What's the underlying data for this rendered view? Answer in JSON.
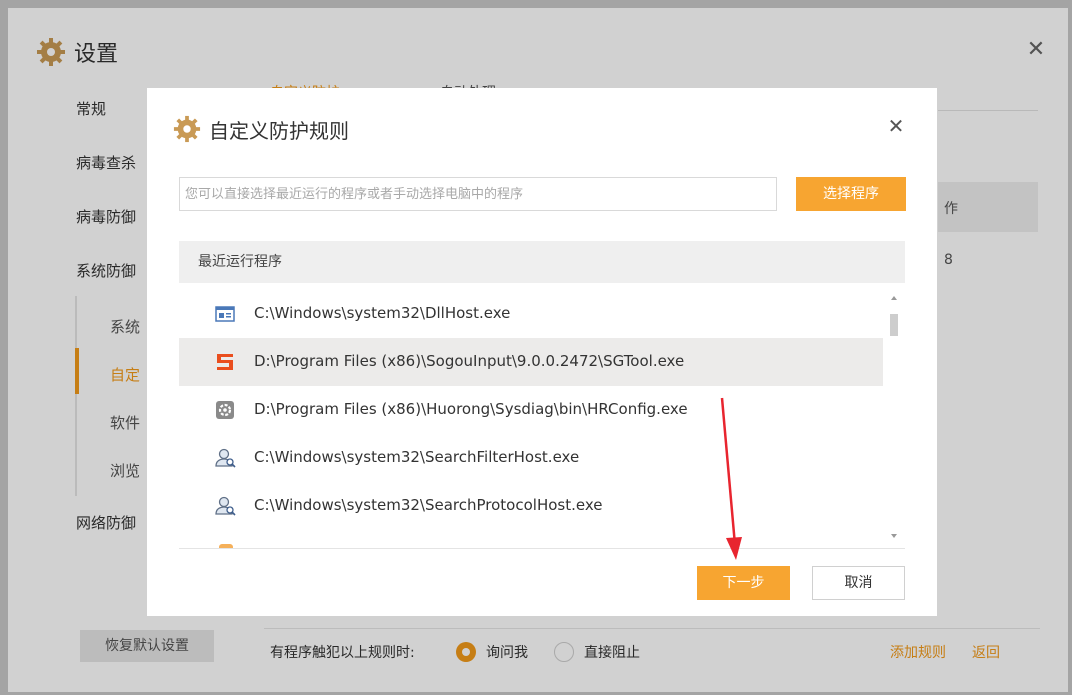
{
  "settings": {
    "title": "设置",
    "nav": [
      "常规",
      "病毒查杀",
      "病毒防御",
      "系统防御",
      "网络防御"
    ],
    "sub_nav": [
      "系统",
      "自定",
      "软件",
      "浏览"
    ],
    "tab_hints": [
      "自定义防护",
      "自动处理"
    ],
    "right_fragments": [
      "作",
      "8"
    ],
    "restore_label": "恢复默认设置",
    "footer_prompt": "有程序触犯以上规则时:",
    "option_ask": "询问我",
    "option_block": "直接阻止",
    "add_rule": "添加规则",
    "back": "返回",
    "close_symbol": "✕"
  },
  "dialog": {
    "title": "自定义防护规则",
    "close_symbol": "✕",
    "search_placeholder": "您可以直接选择最近运行的程序或者手动选择电脑中的程序",
    "choose_button": "选择程序",
    "list_header": "最近运行程序",
    "programs": [
      {
        "path": "C:\\Windows\\system32\\DllHost.exe",
        "icon": "window-app-icon",
        "selected": false
      },
      {
        "path": "D:\\Program Files (x86)\\SogouInput\\9.0.0.2472\\SGTool.exe",
        "icon": "sogou-icon",
        "selected": true
      },
      {
        "path": "D:\\Program Files (x86)\\Huorong\\Sysdiag\\bin\\HRConfig.exe",
        "icon": "config-gear-icon",
        "selected": false
      },
      {
        "path": "C:\\Windows\\system32\\SearchFilterHost.exe",
        "icon": "search-user-icon",
        "selected": false
      },
      {
        "path": "C:\\Windows\\system32\\SearchProtocolHost.exe",
        "icon": "search-user-icon",
        "selected": false
      }
    ],
    "next_button": "下一步",
    "cancel_button": "取消"
  },
  "colors": {
    "accent": "#f7a531",
    "selected_row": "#ecebea",
    "annotation_arrow": "#e8252f"
  }
}
